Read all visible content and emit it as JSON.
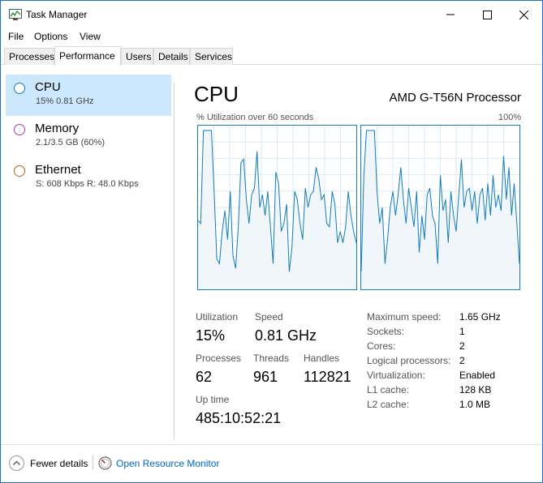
{
  "window": {
    "title": "Task Manager"
  },
  "menu": [
    "File",
    "Options",
    "View"
  ],
  "tabs": [
    "Processes",
    "Performance",
    "Users",
    "Details",
    "Services"
  ],
  "sidebar": {
    "items": [
      {
        "name": "CPU",
        "sub": "15%  0.81 GHz",
        "color": "#1777c9"
      },
      {
        "name": "Memory",
        "sub": "2.1/3.5 GB (60%)",
        "color": "#a73db0"
      },
      {
        "name": "Ethernet",
        "sub": "S: 608 Kbps  R: 48.0 Kbps",
        "color": "#b5651d"
      }
    ]
  },
  "main": {
    "title": "CPU",
    "processor": "AMD G-T56N Processor",
    "graph_label": "% Utilization over 60 seconds",
    "graph_max": "100%",
    "stats": {
      "utilization_label": "Utilization",
      "utilization": "15%",
      "speed_label": "Speed",
      "speed": "0.81 GHz",
      "processes_label": "Processes",
      "processes": "62",
      "threads_label": "Threads",
      "threads": "961",
      "handles_label": "Handles",
      "handles": "112821",
      "uptime_label": "Up time",
      "uptime": "485:10:52:21"
    },
    "details": [
      {
        "label": "Maximum speed:",
        "value": "1.65 GHz"
      },
      {
        "label": "Sockets:",
        "value": "1"
      },
      {
        "label": "Cores:",
        "value": "2"
      },
      {
        "label": "Logical processors:",
        "value": "2"
      },
      {
        "label": "Virtualization:",
        "value": "Enabled"
      },
      {
        "label": "L1 cache:",
        "value": "128 KB"
      },
      {
        "label": "L2 cache:",
        "value": "1.0 MB"
      }
    ]
  },
  "footer": {
    "fewer": "Fewer details",
    "resmon": "Open Resource Monitor"
  },
  "chart_data": [
    {
      "type": "area",
      "ylim": [
        0,
        100
      ],
      "series": [
        {
          "values": [
            42,
            40,
            98,
            98,
            98,
            98,
            60,
            18,
            15,
            35,
            48,
            30,
            60,
            20,
            12,
            38,
            78,
            80,
            55,
            40,
            58,
            62,
            85,
            50,
            58,
            45,
            60,
            38,
            15,
            72,
            65,
            35,
            40,
            52,
            10,
            25,
            60,
            55,
            40,
            30,
            62,
            50,
            58,
            60,
            75,
            68,
            55,
            58,
            40,
            38,
            60,
            52,
            28,
            35,
            28,
            38,
            60,
            45,
            35,
            28
          ]
        }
      ],
      "color": "#117dbb"
    },
    {
      "type": "area",
      "ylim": [
        0,
        100
      ],
      "series": [
        {
          "values": [
            10,
            70,
            98,
            98,
            98,
            98,
            60,
            40,
            50,
            15,
            30,
            50,
            60,
            45,
            58,
            75,
            55,
            40,
            62,
            50,
            38,
            60,
            22,
            45,
            30,
            58,
            62,
            45,
            40,
            15,
            70,
            48,
            55,
            28,
            60,
            45,
            35,
            58,
            80,
            50,
            60,
            62,
            48,
            60,
            40,
            58,
            62,
            42,
            65,
            45,
            70,
            50,
            58,
            48,
            82,
            55,
            75,
            45,
            65,
            40,
            15
          ]
        }
      ],
      "color": "#117dbb"
    }
  ]
}
